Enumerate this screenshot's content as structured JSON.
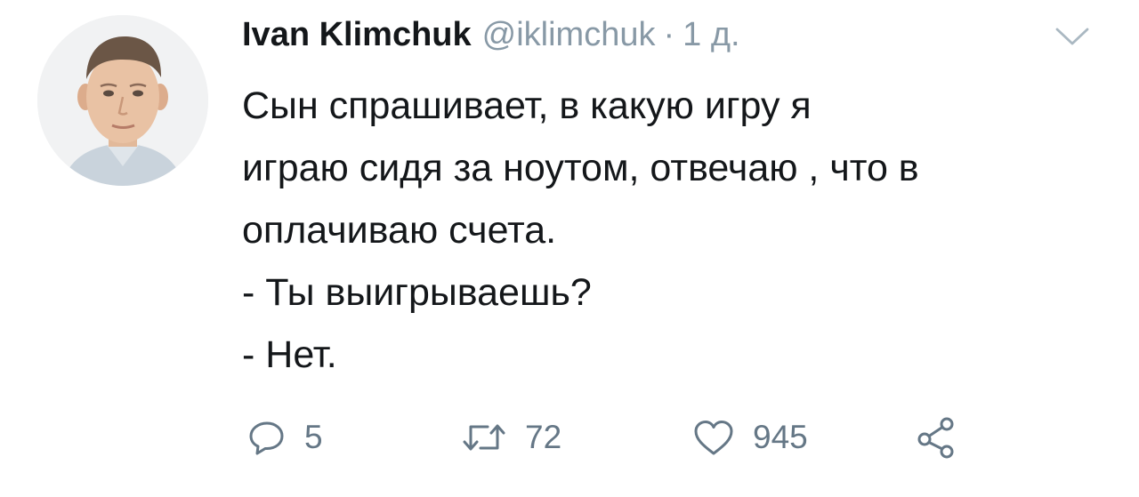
{
  "tweet": {
    "author": {
      "display_name": "Ivan Klimchuk",
      "handle": "@iklimchuk",
      "separator": "·",
      "timestamp": "1 д."
    },
    "text_lines": [
      "Сын спрашивает, в какую игру я",
      "играю сидя за ноутом, отвечаю , что в",
      "оплачиваю счета.",
      "- Ты выигрываешь?",
      "- Нет."
    ],
    "actions": {
      "reply_count": "5",
      "retweet_count": "72",
      "like_count": "945"
    }
  },
  "icons": {
    "reply": "reply-icon",
    "retweet": "retweet-icon",
    "like": "heart-icon",
    "share": "share-icon",
    "menu": "chevron-down-icon"
  },
  "colors": {
    "text": "#14171a",
    "secondary_text": "#8899a6",
    "action_icon": "#657786"
  }
}
